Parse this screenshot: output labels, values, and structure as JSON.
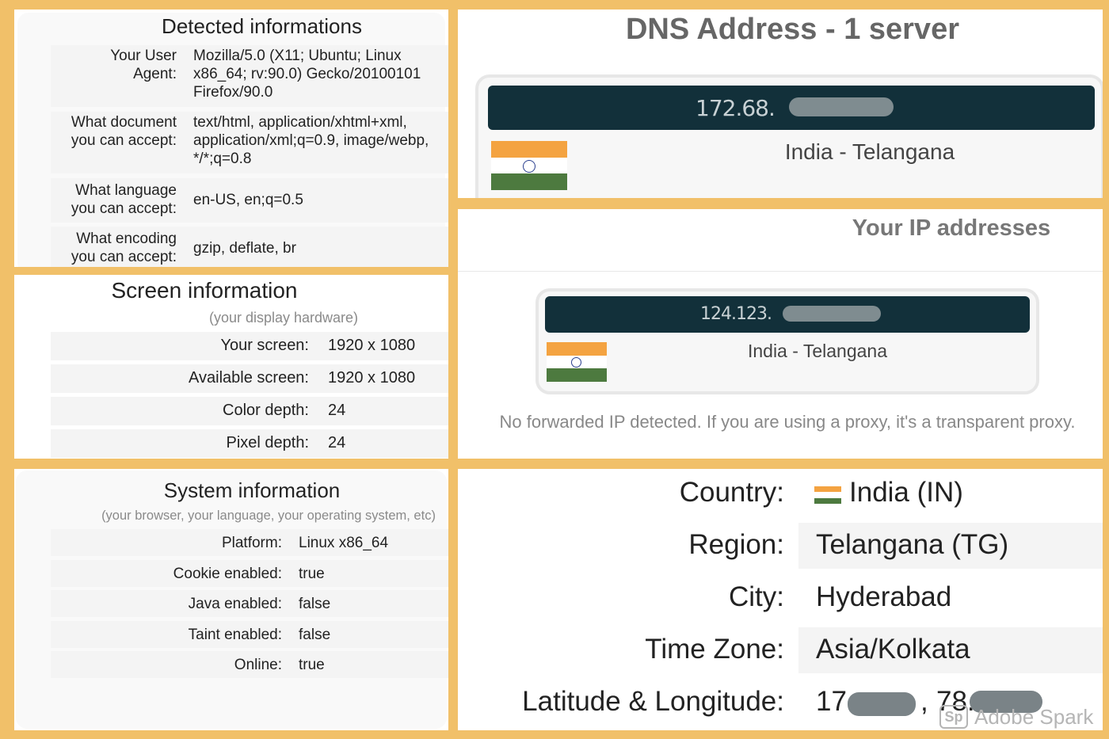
{
  "detected": {
    "title": "Detected informations",
    "rows": [
      {
        "key_line1": "Your User",
        "key_line2": "Agent:",
        "value_lines": [
          "Mozilla/5.0 (X11; Ubuntu; Linux",
          "x86_64; rv:90.0) Gecko/20100101",
          "Firefox/90.0"
        ]
      },
      {
        "key_line1": "What document",
        "key_line2": "you can accept:",
        "value_lines": [
          "text/html, application/xhtml+xml,",
          "application/xml;q=0.9, image/webp,",
          "*/*;q=0.8"
        ]
      },
      {
        "key_line1": "What language",
        "key_line2": "you can accept:",
        "value_lines": [
          "en-US, en;q=0.5"
        ]
      },
      {
        "key_line1": "What encoding",
        "key_line2": "you can accept:",
        "value_lines": [
          "gzip, deflate, br"
        ]
      }
    ]
  },
  "screen": {
    "title": "Screen information",
    "subtitle": "(your display hardware)",
    "rows": [
      {
        "key": "Your screen:",
        "value": "1920 x 1080"
      },
      {
        "key": "Available screen:",
        "value": "1920 x 1080"
      },
      {
        "key": "Color depth:",
        "value": "24"
      },
      {
        "key": "Pixel depth:",
        "value": "24"
      }
    ]
  },
  "system": {
    "title": "System information",
    "subtitle": "(your browser, your language, your operating system, etc)",
    "rows": [
      {
        "key": "Platform:",
        "value": "Linux x86_64"
      },
      {
        "key": "Cookie enabled:",
        "value": "true"
      },
      {
        "key": "Java enabled:",
        "value": "false"
      },
      {
        "key": "Taint enabled:",
        "value": "false"
      },
      {
        "key": "Online:",
        "value": "true"
      }
    ]
  },
  "dns": {
    "title": "DNS Address - 1 server",
    "ip_prefix": "172.68.",
    "location": "India - Telangana"
  },
  "ip": {
    "title": "Your IP addresses",
    "ip_prefix": "124.123.",
    "location": "India - Telangana",
    "note": "No forwarded IP detected. If you are using a proxy, it's a transparent proxy."
  },
  "geo": {
    "rows": [
      {
        "key": "Country:",
        "value": "India (IN)"
      },
      {
        "key": "Region:",
        "value": "Telangana (TG)"
      },
      {
        "key": "City:",
        "value": "Hyderabad"
      },
      {
        "key": "Time Zone:",
        "value": "Asia/Kolkata"
      },
      {
        "key": "Latitude & Longitude:",
        "value_a": "17.",
        "sep": ",",
        "value_b": "78."
      }
    ]
  },
  "watermark": {
    "logo": "Sp",
    "text": "Adobe Spark"
  },
  "colors": {
    "frame": "#f1c069",
    "ip_bar": "#12303a",
    "saffron": "#f4a341",
    "green": "#4d7a3f",
    "chakra": "#2a3f8f"
  }
}
